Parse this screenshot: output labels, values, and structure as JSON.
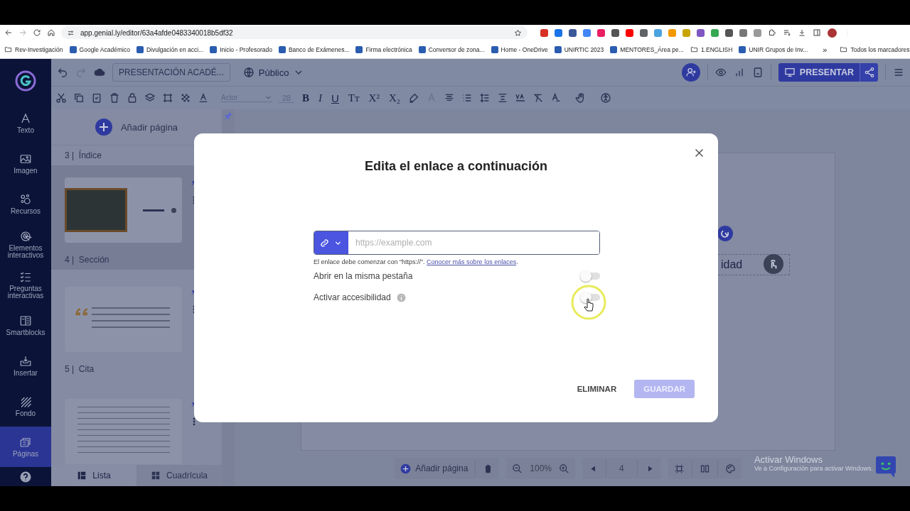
{
  "browser": {
    "url": "app.genial.ly/editor/63a4afde0483340018b5df32",
    "bookmarks": [
      {
        "label": "Rev-Investigación",
        "kind": "folder"
      },
      {
        "label": "Google Académico",
        "kind": "site"
      },
      {
        "label": "Divulgación en acci...",
        "kind": "site"
      },
      {
        "label": "Inicio - Profesorado",
        "kind": "site"
      },
      {
        "label": "Banco de Exámenes...",
        "kind": "site"
      },
      {
        "label": "Firma electrónica",
        "kind": "site"
      },
      {
        "label": "Conversor de zona...",
        "kind": "site"
      },
      {
        "label": "Home - OneDrive",
        "kind": "site"
      },
      {
        "label": "UNIRTIC 2023",
        "kind": "site"
      },
      {
        "label": "MENTORES_Área pe...",
        "kind": "site"
      },
      {
        "label": "1.ENGLISH",
        "kind": "folder"
      },
      {
        "label": "UNIR Grupos de Inv...",
        "kind": "site"
      }
    ],
    "more": "»",
    "all_bookmarks": "Todos los marcadores"
  },
  "sidebar": {
    "items": [
      {
        "label": "Texto",
        "selected": false
      },
      {
        "label": "Imagen",
        "selected": false
      },
      {
        "label": "Recursos",
        "selected": false
      },
      {
        "label": "Elementos interactivos",
        "selected": false
      },
      {
        "label": "Preguntas interactivas",
        "selected": false
      },
      {
        "label": "Smartblocks",
        "selected": false
      },
      {
        "label": "Insertar",
        "selected": false
      },
      {
        "label": "Fondo",
        "selected": false
      },
      {
        "label": "Páginas",
        "selected": true
      }
    ]
  },
  "toolbar": {
    "title": "PRESENTACIÓN ACADÉ...",
    "visibility": "Público",
    "present": "PRESENTAR",
    "font": "Actor",
    "font_size": "28",
    "format": [
      "B",
      "I",
      "U",
      "Tт",
      "X²",
      "X₂"
    ]
  },
  "pages_panel": {
    "add": "Añadir página",
    "entries": [
      {
        "kind": "caption",
        "number": "3 |",
        "title": "Índice",
        "selected": false
      },
      {
        "kind": "photo-thumb",
        "selected": true
      },
      {
        "kind": "caption",
        "number": "4 |",
        "title": "Sección",
        "selected": true
      },
      {
        "kind": "quote-thumb",
        "selected": false
      },
      {
        "kind": "caption",
        "number": "5 |",
        "title": "Cita",
        "selected": false
      },
      {
        "kind": "list-thumb",
        "selected": false
      }
    ],
    "views": [
      {
        "label": "Lista",
        "selected": true
      },
      {
        "label": "Cuadrícula",
        "selected": false
      }
    ]
  },
  "canvas": {
    "slide_text": "idad"
  },
  "bottom_bar": {
    "add": "Añadir página",
    "zoom": "100%",
    "page": "4"
  },
  "modal": {
    "title": "Edita el enlace a continuación",
    "placeholder": "https://example.com",
    "hint": "El enlace debe comenzar con “https://”.",
    "hint_link": "Conocer más sobre los enlaces",
    "hint_end": ".",
    "options": [
      {
        "label": "Abrir en la misma pestaña",
        "on": false,
        "info": false
      },
      {
        "label": "Activar accesibilidad",
        "on": false,
        "info": true
      }
    ],
    "buttons": [
      {
        "label": "ELIMINAR",
        "kind": "text",
        "disabled": false
      },
      {
        "label": "GUARDAR",
        "kind": "primary",
        "disabled": true
      }
    ]
  },
  "windows_notice": {
    "title": "Activar Windows",
    "subtitle": "Ve a Configuración para activar Windows."
  }
}
